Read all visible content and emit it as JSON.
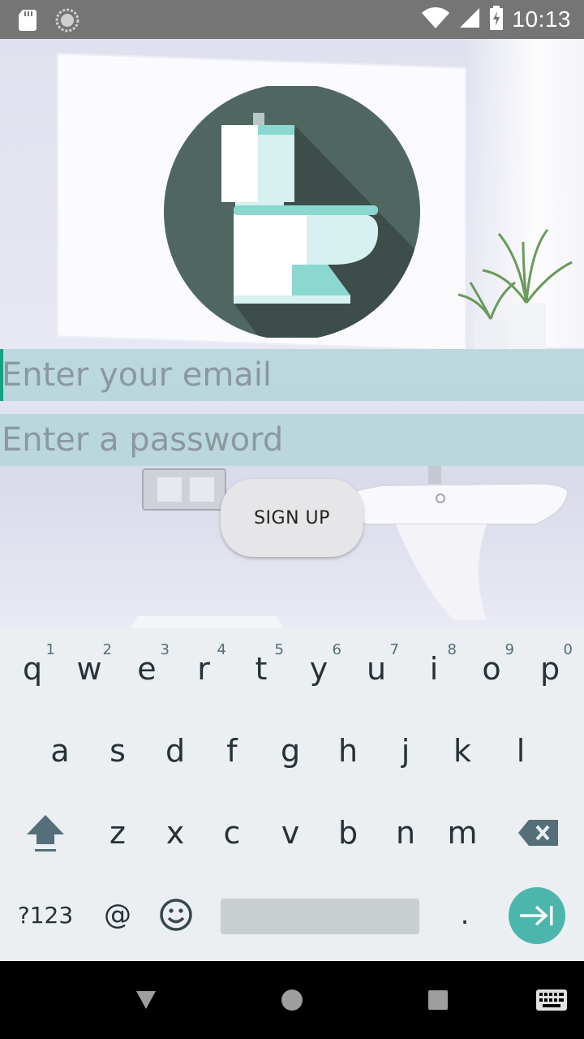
{
  "status_bar": {
    "time": "10:13",
    "icons": [
      "sd-card-icon",
      "sync-icon",
      "wifi-icon",
      "signal-icon",
      "battery-charging-icon"
    ]
  },
  "form": {
    "email_placeholder": "Enter your email",
    "password_placeholder": "Enter a password",
    "signup_label": "SIGN UP"
  },
  "keyboard": {
    "row1": [
      {
        "key": "q",
        "hint": "1"
      },
      {
        "key": "w",
        "hint": "2"
      },
      {
        "key": "e",
        "hint": "3"
      },
      {
        "key": "r",
        "hint": "4"
      },
      {
        "key": "t",
        "hint": "5"
      },
      {
        "key": "y",
        "hint": "6"
      },
      {
        "key": "u",
        "hint": "7"
      },
      {
        "key": "i",
        "hint": "8"
      },
      {
        "key": "o",
        "hint": "9"
      },
      {
        "key": "p",
        "hint": "0"
      }
    ],
    "row2": [
      "a",
      "s",
      "d",
      "f",
      "g",
      "h",
      "j",
      "k",
      "l"
    ],
    "row3": [
      "z",
      "x",
      "c",
      "v",
      "b",
      "n",
      "m"
    ],
    "symbols_label": "?123",
    "at_label": "@",
    "period_label": "."
  },
  "colors": {
    "status_bar": "#757575",
    "field_bg": "#b7d6dd",
    "cursor": "#16a085",
    "enter_key": "#4db6ac",
    "keyboard_bg": "#ebeff1"
  }
}
